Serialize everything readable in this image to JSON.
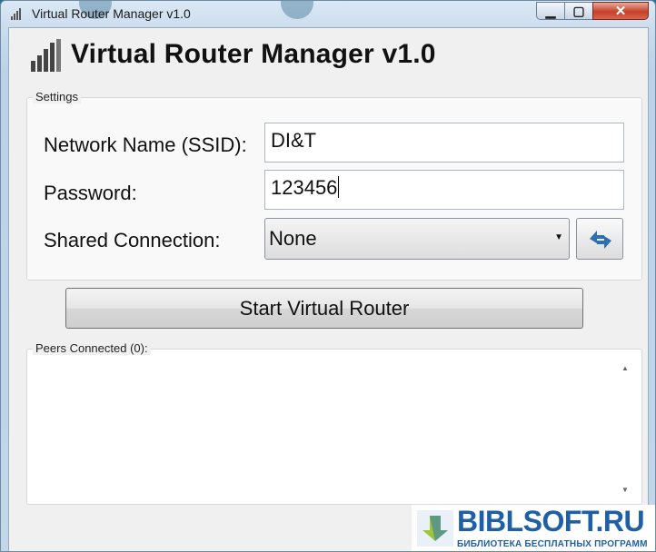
{
  "window": {
    "title": "Virtual Router Manager v1.0"
  },
  "header": {
    "title": "Virtual Router Manager v1.0"
  },
  "settings": {
    "group_label": "Settings",
    "ssid_label": "Network Name (SSID):",
    "ssid_value": "DI&T",
    "password_label": "Password:",
    "password_value": "123456",
    "shared_label": "Shared Connection:",
    "shared_value": "None"
  },
  "actions": {
    "start_label": "Start Virtual Router"
  },
  "peers": {
    "label": "Peers Connected (0):"
  },
  "watermark": {
    "title": "BIBLSOFT.RU",
    "subtitle": "БИБЛИОТЕКА БЕСПЛАТНЫХ ПРОГРАММ"
  },
  "icons": {
    "app": "signal-bars-icon",
    "minimize": "minimize-icon",
    "maximize": "maximize-icon",
    "close": "close-icon",
    "refresh": "refresh-icon",
    "dropdown": "chevron-down-icon"
  }
}
